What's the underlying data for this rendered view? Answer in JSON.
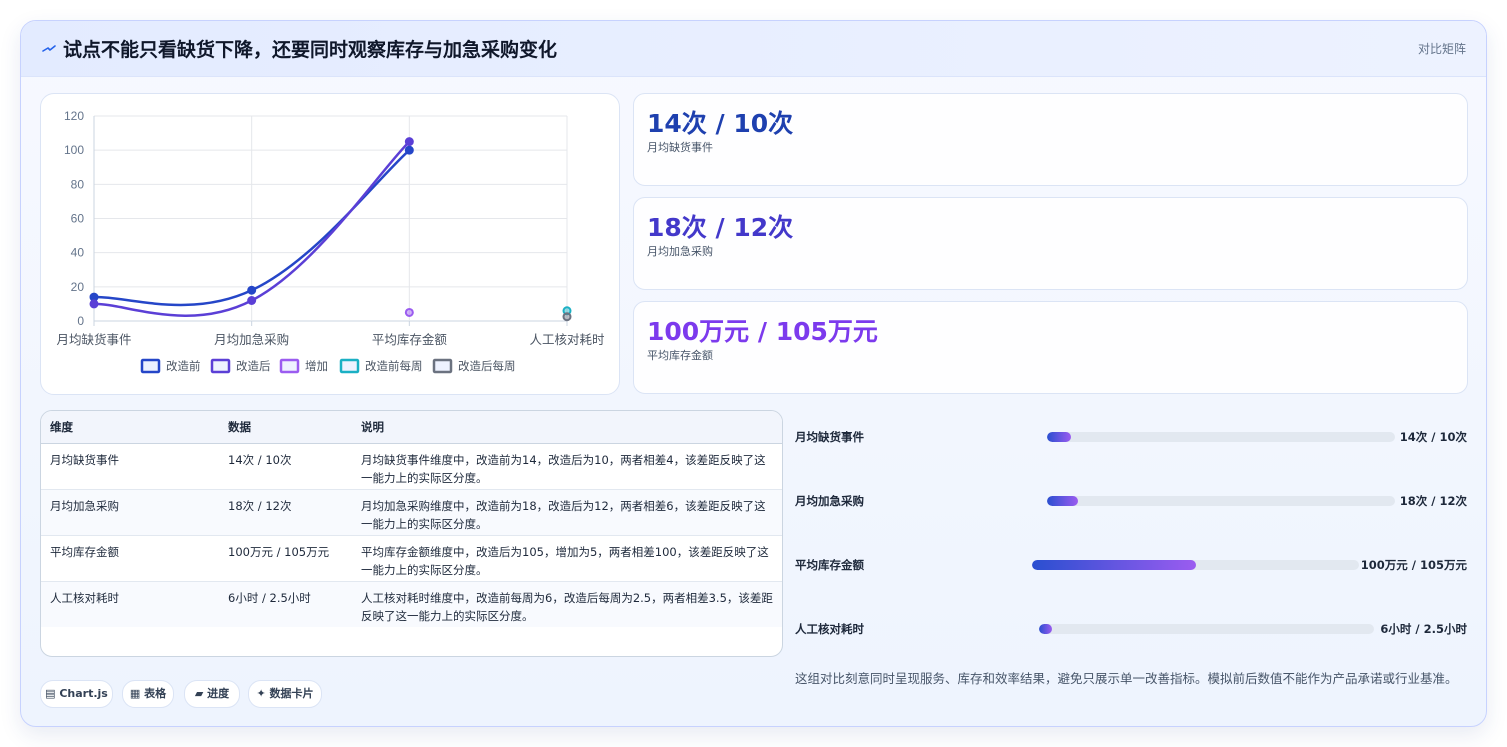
{
  "header": {
    "title": "试点不能只看缺货下降，还要同时观察库存与加急采购变化",
    "tag": "对比矩阵",
    "icon": "trend-icon"
  },
  "colors": {
    "before": "#2546c8",
    "after": "#5b3fd6",
    "increase": "#9b5cf0",
    "before_weekly": "#1bb0c4",
    "after_weekly": "#6b7280"
  },
  "chart_data": {
    "type": "line",
    "categories": [
      "月均缺货事件",
      "月均加急采购",
      "平均库存金额",
      "人工核对耗时"
    ],
    "ylim": [
      0,
      120
    ],
    "yticks": [
      0,
      20,
      40,
      60,
      80,
      100,
      120
    ],
    "grid": true,
    "legend_position": "bottom",
    "series": [
      {
        "name": "改造前",
        "values": [
          14,
          18,
          100,
          null
        ],
        "color": "#2546c8",
        "line": true
      },
      {
        "name": "改造后",
        "values": [
          10,
          12,
          105,
          null
        ],
        "color": "#5b3fd6",
        "line": true
      },
      {
        "name": "增加",
        "values": [
          null,
          null,
          5,
          null
        ],
        "color": "#9b5cf0",
        "line": false
      },
      {
        "name": "改造前每周",
        "values": [
          null,
          null,
          null,
          6
        ],
        "color": "#1bb0c4",
        "line": false
      },
      {
        "name": "改造后每周",
        "values": [
          null,
          null,
          null,
          2.5
        ],
        "color": "#6b7280",
        "line": false
      }
    ]
  },
  "stats": [
    {
      "value": "14次 / 10次",
      "label": "月均缺货事件",
      "color": "#1e40af"
    },
    {
      "value": "18次 / 12次",
      "label": "月均加急采购",
      "color": "#4338ca"
    },
    {
      "value": "100万元 / 105万元",
      "label": "平均库存金额",
      "color": "#7c3aed"
    }
  ],
  "table": {
    "headers": [
      "维度",
      "数据",
      "说明"
    ],
    "rows": [
      [
        "月均缺货事件",
        "14次 / 10次",
        "月均缺货事件维度中，改造前为14，改造后为10，两者相差4，该差距反映了这一能力上的实际区分度。"
      ],
      [
        "月均加急采购",
        "18次 / 12次",
        "月均加急采购维度中，改造前为18，改造后为12，两者相差6，该差距反映了这一能力上的实际区分度。"
      ],
      [
        "平均库存金额",
        "100万元 / 105万元",
        "平均库存金额维度中，改造后为105，增加为5，两者相差100，该差距反映了这一能力上的实际区分度。"
      ],
      [
        "人工核对耗时",
        "6小时 / 2.5小时",
        "人工核对耗时维度中，改造前每周为6，改造后每周为2.5，两者相差3.5，该差距反映了这一能力上的实际区分度。"
      ]
    ]
  },
  "progress": [
    {
      "label": "月均缺货事件",
      "value": "14次 / 10次",
      "fill": 0.07
    },
    {
      "label": "月均加急采购",
      "value": "18次 / 12次",
      "fill": 0.09
    },
    {
      "label": "平均库存金额",
      "value": "100万元 / 105万元",
      "fill": 0.5
    },
    {
      "label": "人工核对耗时",
      "value": "6小时 / 2.5小时",
      "fill": 0.04
    }
  ],
  "chips": [
    {
      "icon": "chart-icon",
      "label": "▤ Chart.js"
    },
    {
      "icon": "table-icon",
      "label": "▦ 表格"
    },
    {
      "icon": "progress-icon",
      "label": "▰ 进度"
    },
    {
      "icon": "sparkle-icon",
      "label": "✦ 数据卡片"
    }
  ],
  "note": "这组对比刻意同时呈现服务、库存和效率结果，避免只展示单一改善指标。模拟前后数值不能作为产品承诺或行业基准。"
}
